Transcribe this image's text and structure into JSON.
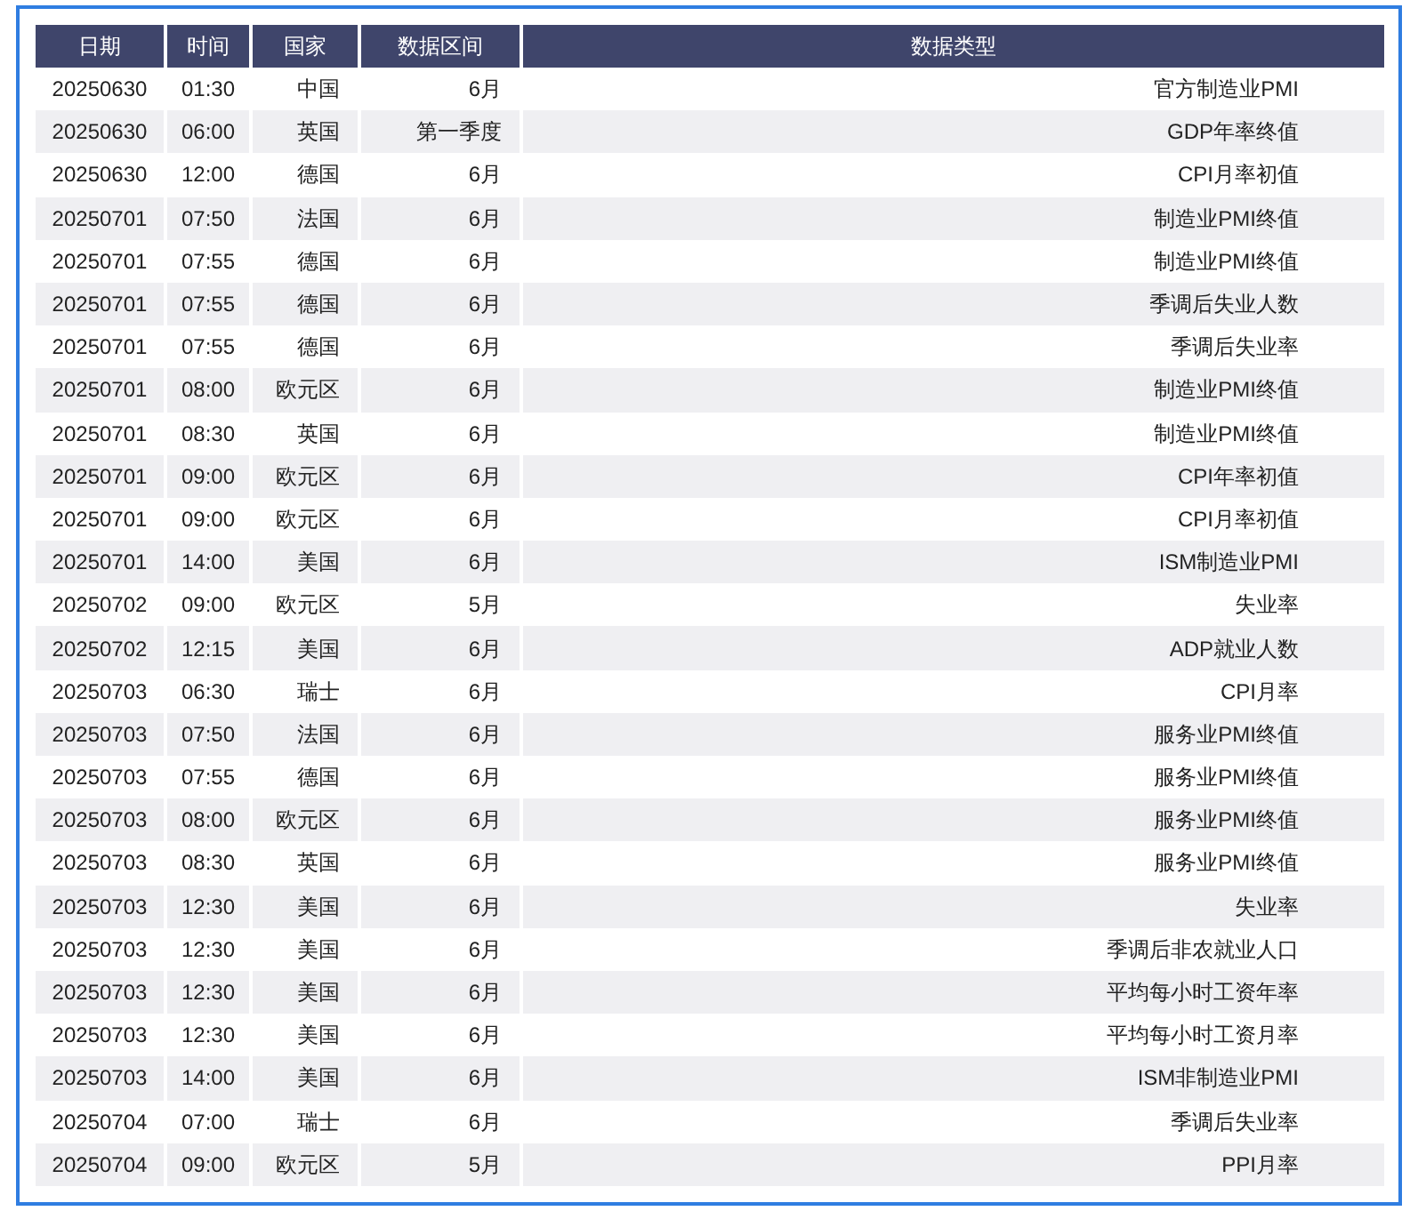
{
  "table": {
    "columns": [
      "日期",
      "时间",
      "国家",
      "数据区间",
      "数据类型"
    ],
    "rows": [
      [
        "20250630",
        "01:30",
        "中国",
        "6月",
        "官方制造业PMI"
      ],
      [
        "20250630",
        "06:00",
        "英国",
        "第一季度",
        "GDP年率终值"
      ],
      [
        "20250630",
        "12:00",
        "德国",
        "6月",
        "CPI月率初值"
      ],
      [
        "20250701",
        "07:50",
        "法国",
        "6月",
        "制造业PMI终值"
      ],
      [
        "20250701",
        "07:55",
        "德国",
        "6月",
        "制造业PMI终值"
      ],
      [
        "20250701",
        "07:55",
        "德国",
        "6月",
        "季调后失业人数"
      ],
      [
        "20250701",
        "07:55",
        "德国",
        "6月",
        "季调后失业率"
      ],
      [
        "20250701",
        "08:00",
        "欧元区",
        "6月",
        "制造业PMI终值"
      ],
      [
        "20250701",
        "08:30",
        "英国",
        "6月",
        "制造业PMI终值"
      ],
      [
        "20250701",
        "09:00",
        "欧元区",
        "6月",
        "CPI年率初值"
      ],
      [
        "20250701",
        "09:00",
        "欧元区",
        "6月",
        "CPI月率初值"
      ],
      [
        "20250701",
        "14:00",
        "美国",
        "6月",
        "ISM制造业PMI"
      ],
      [
        "20250702",
        "09:00",
        "欧元区",
        "5月",
        "失业率"
      ],
      [
        "20250702",
        "12:15",
        "美国",
        "6月",
        "ADP就业人数"
      ],
      [
        "20250703",
        "06:30",
        "瑞士",
        "6月",
        "CPI月率"
      ],
      [
        "20250703",
        "07:50",
        "法国",
        "6月",
        "服务业PMI终值"
      ],
      [
        "20250703",
        "07:55",
        "德国",
        "6月",
        "服务业PMI终值"
      ],
      [
        "20250703",
        "08:00",
        "欧元区",
        "6月",
        "服务业PMI终值"
      ],
      [
        "20250703",
        "08:30",
        "英国",
        "6月",
        "服务业PMI终值"
      ],
      [
        "20250703",
        "12:30",
        "美国",
        "6月",
        "失业率"
      ],
      [
        "20250703",
        "12:30",
        "美国",
        "6月",
        "季调后非农就业人口"
      ],
      [
        "20250703",
        "12:30",
        "美国",
        "6月",
        "平均每小时工资年率"
      ],
      [
        "20250703",
        "12:30",
        "美国",
        "6月",
        "平均每小时工资月率"
      ],
      [
        "20250703",
        "14:00",
        "美国",
        "6月",
        "ISM非制造业PMI"
      ],
      [
        "20250704",
        "07:00",
        "瑞士",
        "6月",
        "季调后失业率"
      ],
      [
        "20250704",
        "09:00",
        "欧元区",
        "5月",
        "PPI月率"
      ]
    ]
  }
}
